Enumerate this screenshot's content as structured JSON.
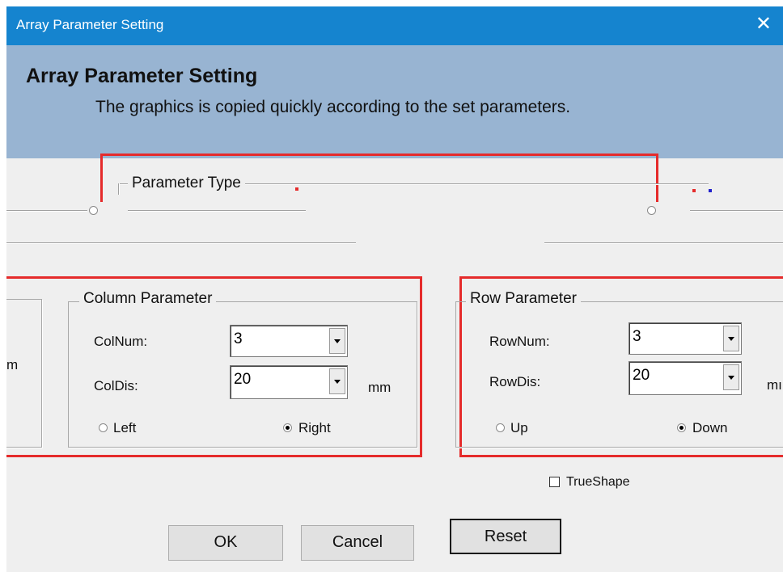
{
  "window": {
    "title": "Array Parameter Setting",
    "close_symbol": "✕"
  },
  "banner": {
    "heading": "Array Parameter Setting",
    "description": "The graphics is copied quickly according to the set parameters."
  },
  "parameter_type": {
    "legend": "Parameter Type"
  },
  "left_group_fragment": {
    "unit": "m"
  },
  "column": {
    "legend": "Column Parameter",
    "num_label": "ColNum:",
    "num_value": "3",
    "dis_label": "ColDis:",
    "dis_value": "20",
    "unit": "mm",
    "left_label": "Left",
    "right_label": "Right",
    "selected": "Right"
  },
  "row": {
    "legend": "Row Parameter",
    "num_label": "RowNum:",
    "num_value": "3",
    "dis_label": "RowDis:",
    "dis_value": "20",
    "unit": "mı",
    "up_label": "Up",
    "down_label": "Down",
    "selected": "Down"
  },
  "trueshape": {
    "label": "TrueShape",
    "checked": false
  },
  "buttons": {
    "ok": "OK",
    "cancel": "Cancel",
    "reset": "Reset"
  },
  "colors": {
    "title_bar": "#1584cf",
    "banner": "#98b4d2",
    "highlight": "#e52b2b",
    "dialog_bg": "#efefef"
  }
}
